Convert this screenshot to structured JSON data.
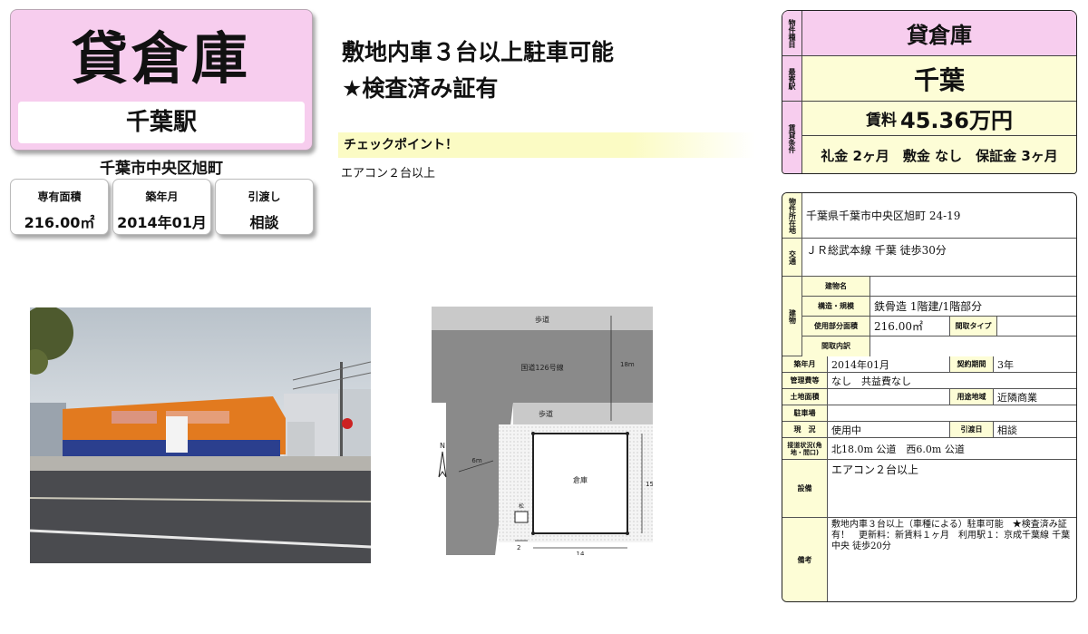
{
  "header": {
    "property_type": "貸倉庫",
    "station": "千葉駅",
    "address_short": "千葉市中央区旭町",
    "boxes": [
      {
        "label": "専有面積",
        "value": "216.00㎡"
      },
      {
        "label": "築年月",
        "value": "2014年01月"
      },
      {
        "label": "引渡し",
        "value": "相談"
      }
    ]
  },
  "headline": {
    "line1": "敷地内車３台以上駐車可能",
    "line2": "★検査済み証有"
  },
  "checkpoint": {
    "title": "チェックポイント！",
    "text": "エアコン２台以上"
  },
  "plan": {
    "sidewalk_top": "歩道",
    "road": "国道126号線",
    "road_width": "18m",
    "sidewalk_mid": "歩道",
    "side_road": "6m",
    "warehouse": "倉庫",
    "dim_side": "15",
    "dim_bottom": "14",
    "dim_small": "2",
    "north": "N",
    "marker": "松"
  },
  "summary": {
    "type_key": "物件種目",
    "type_value": "貸倉庫",
    "station_key": "最寄駅",
    "station_value": "千葉",
    "rent_key": "賃貸条件",
    "rent_label": "賃料",
    "rent_value": "45.36万円",
    "fees": "礼金 2ヶ月　敷金 なし　保証金 3ヶ月"
  },
  "detail": {
    "location_key": "物件所在地",
    "location": "千葉県千葉市中央区旭町 24-19",
    "transport_key": "交通",
    "transport": "ＪＲ総武本線 千葉 徒歩30分",
    "building_key": "建物",
    "building_name_key": "建物名",
    "building_name": "",
    "structure_key": "構造・規模",
    "structure": "鉄骨造 1階建/1階部分",
    "area_key": "使用部分面積",
    "area": "216.00㎡",
    "layout_key": "間取タイプ",
    "layout": "",
    "layout_detail_key": "間取内訳",
    "layout_detail": "",
    "built_key": "築年月",
    "built": "2014年01月",
    "contract_key": "契約期間",
    "contract": "3年",
    "mgmt_key": "管理費等",
    "mgmt": "なし　共益費なし",
    "land_key": "土地面積",
    "land": "",
    "zoning_key": "用途地域",
    "zoning": "近隣商業",
    "parking_key": "駐車場",
    "parking": "",
    "status_key": "現　況",
    "status": "使用中",
    "handover_key": "引渡日",
    "handover": "相談",
    "road_key": "接道状況(角地・間口)",
    "road": "北18.0m 公道　西6.0m 公道",
    "equip_key": "設備",
    "equip": "エアコン２台以上",
    "notes_key": "備考",
    "notes": "敷地内車３台以上（車種による）駐車可能　★検査済み証有！　更新料：新賃料１ヶ月　利用駅１：京成千葉線 千葉中央 徒歩20分"
  }
}
